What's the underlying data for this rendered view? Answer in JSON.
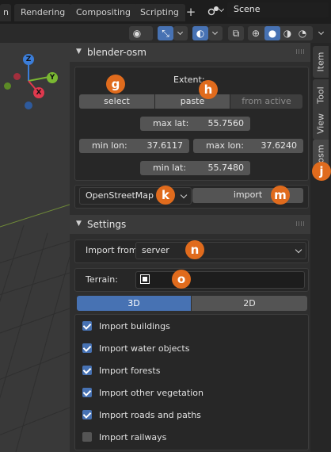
{
  "workspace_tabs": [
    "n",
    "Rendering",
    "Compositing",
    "Scripting"
  ],
  "add_tab": "+",
  "scene": "Scene",
  "gizmo": {
    "x": "X",
    "y": "Y",
    "z": "Z"
  },
  "sidebar_tabs": [
    "Item",
    "Tool",
    "View",
    "osm"
  ],
  "panel_osm": {
    "title": "blender-osm",
    "extent_label": "Extent:",
    "buttons": {
      "select": "select",
      "paste": "paste",
      "from_active": "from active"
    },
    "max_lat": {
      "label": "max lat:",
      "value": "55.7560"
    },
    "min_lon": {
      "label": "min lon:",
      "value": "37.6117"
    },
    "max_lon": {
      "label": "max lon:",
      "value": "37.6240"
    },
    "min_lat": {
      "label": "min lat:",
      "value": "55.7480"
    },
    "source": "OpenStreetMap",
    "import_button": "import"
  },
  "panel_settings": {
    "title": "Settings",
    "import_from_label": "Import from:",
    "import_from_value": "server",
    "terrain_label": "Terrain:",
    "mode_tabs": [
      "3D",
      "2D"
    ],
    "options": [
      {
        "label": "Import buildings",
        "checked": true
      },
      {
        "label": "Import water objects",
        "checked": true
      },
      {
        "label": "Import forests",
        "checked": true
      },
      {
        "label": "Import other vegetation",
        "checked": true
      },
      {
        "label": "Import roads and paths",
        "checked": true
      },
      {
        "label": "Import railways",
        "checked": false
      }
    ]
  },
  "markers": [
    "g",
    "h",
    "j",
    "k",
    "m",
    "n",
    "o"
  ],
  "colors": {
    "accent": "#4772b3",
    "marker": "#e06b1d"
  }
}
